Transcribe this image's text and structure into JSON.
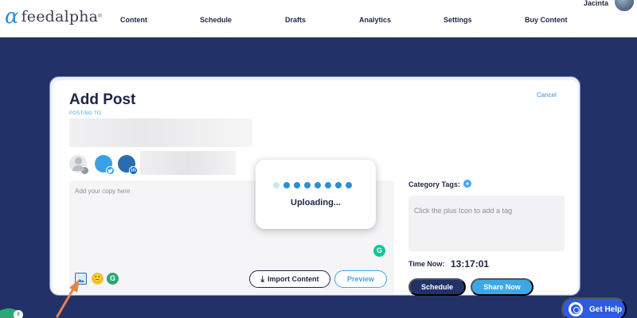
{
  "app": {
    "logo_mark": "α",
    "logo_text": "feedalpha",
    "logo_tm": "®"
  },
  "nav": {
    "items": [
      "Content",
      "Schedule",
      "Drafts",
      "Analytics",
      "Settings",
      "Buy Content"
    ],
    "user_name": "Jacinta"
  },
  "modal": {
    "title": "Add Post",
    "cancel_label": "Cancel",
    "posting_to_label": "POSTING TO:",
    "accounts": [
      {
        "network": "personal",
        "icon": "user-icon"
      },
      {
        "network": "twitter",
        "icon": "twitter-icon"
      },
      {
        "network": "linkedin",
        "icon": "linkedin-icon",
        "badge": "in"
      }
    ],
    "copy_placeholder": "Add your copy here",
    "import_label": "Import Content",
    "preview_label": "Preview",
    "grammarly_glyph": "G"
  },
  "upload": {
    "text": "Uploading...",
    "dots_total": 8,
    "dots_faint": 1
  },
  "sidebar": {
    "category_label": "Category Tags:",
    "tag_placeholder": "Click the plus Icon to add a tag",
    "time_label": "Time Now:",
    "time_value": "13:17:01",
    "schedule_label": "Schedule",
    "share_label": "Share Now"
  },
  "overlay": {
    "notification_count": "9",
    "help_label": "Get Help"
  },
  "colors": {
    "navy": "#223268",
    "accent_blue": "#3ea8e6",
    "annotation_arrow": "#e8844a",
    "grammarly_green": "#15c39a",
    "help_blue": "#2e5be0"
  }
}
